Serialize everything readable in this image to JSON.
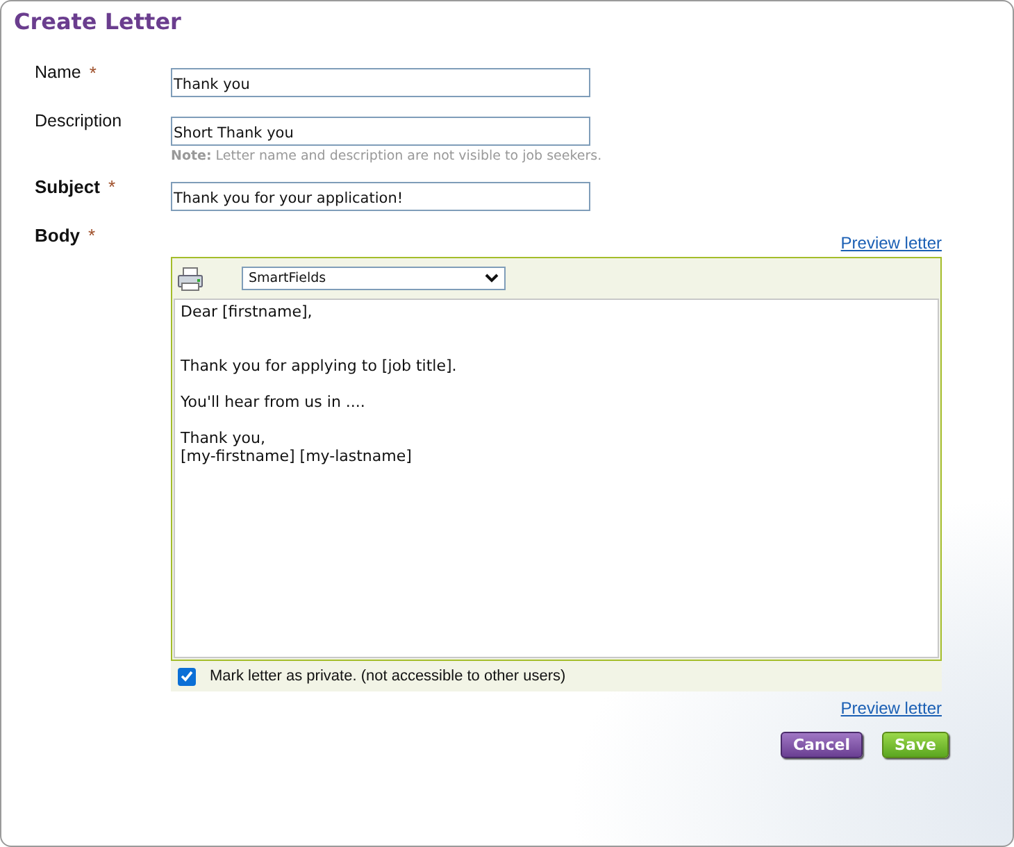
{
  "window": {
    "title": "Create Letter"
  },
  "fields": [
    {
      "label": "Name",
      "required_mark": "*",
      "bold": false,
      "value": "Thank you"
    },
    {
      "label": "Description",
      "bold": false,
      "value": "Short Thank you",
      "note_label": "Note:",
      "note": "Letter name and description are not visible to job seekers."
    },
    {
      "label": "Subject",
      "required_mark": "*",
      "bold": true,
      "value": "Thank you for your application!"
    }
  ],
  "body": {
    "label": "Body",
    "required_mark": "*",
    "preview_link": "Preview letter",
    "smartfields": "SmartFields",
    "text": "Dear [firstname],\n\n\nThank you for applying to [job title].\n\nYou'll hear from us in ....\n\nThank you,\n[my-firstname] [my-lastname]",
    "private": {
      "label": "Mark letter as private. (not accessible to other users)",
      "checked": true
    }
  },
  "preview_link_bottom": "Preview letter",
  "buttons": [
    {
      "label": "Cancel",
      "kind": "cancel"
    },
    {
      "label": "Save",
      "kind": "save"
    }
  ]
}
